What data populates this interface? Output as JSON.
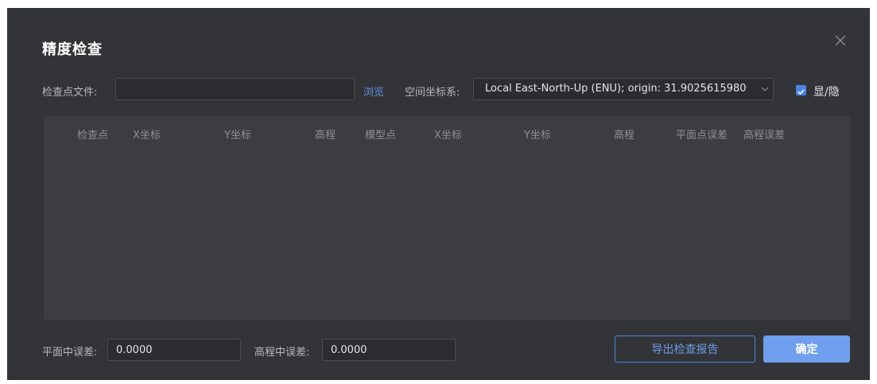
{
  "dialog": {
    "title": "精度检查",
    "close_icon": "close-icon"
  },
  "check_file": {
    "label": "检查点文件:",
    "value": "",
    "browse_label": "浏览"
  },
  "coordinate_system": {
    "label": "空间坐标系:",
    "selected": "Local East-North-Up (ENU); origin: 31.9025615980",
    "arrow_icon": "chevron-down-icon"
  },
  "toggle": {
    "label": "显/隐",
    "checked": true
  },
  "table": {
    "columns": [
      "检查点",
      "X坐标",
      "Y坐标",
      "高程",
      "模型点",
      "X坐标",
      "Y坐标",
      "高程",
      "平面点误差",
      "高程误差"
    ],
    "rows": []
  },
  "footer": {
    "plane_error_label": "平面中误差:",
    "plane_error_value": "0.0000",
    "elevation_error_label": "高程中误差:",
    "elevation_error_value": "0.0000",
    "export_label": "导出检查报告",
    "ok_label": "确定"
  },
  "colors": {
    "background": "#333437",
    "table_background": "#3c3d41",
    "accent": "#4a86e8",
    "primary_button": "#6f9fee"
  }
}
